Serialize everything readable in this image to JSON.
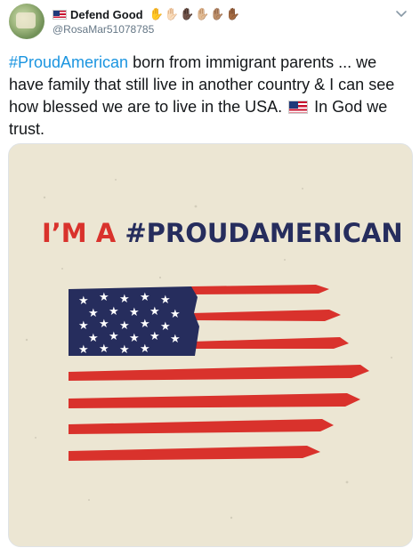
{
  "author": {
    "name": "Defend Good",
    "handle": "@RosaMar51078785"
  },
  "icons": {
    "avatar": "profile-photo",
    "name_flag": "us-flag-icon",
    "hands": [
      "raised-hand-yellow",
      "raised-hand-light",
      "raised-hand-dark",
      "raised-hand-medium-light",
      "raised-hand-medium",
      "raised-hand-brown"
    ],
    "menu": "chevron-down-icon",
    "inline_flag": "us-flag-icon"
  },
  "tweet": {
    "hashtag": "#ProudAmerican",
    "text_part1": " born from immigrant parents ... we have family that still live in another country & I can see how blessed we are to live in the USA. ",
    "text_part2": " In God we trust."
  },
  "image": {
    "headline_red": "I’M A",
    "headline_blue": " #PROUDAMERICAN",
    "colors": {
      "background": "#ece6d3",
      "red": "#d9322c",
      "blue": "#262d5d",
      "white": "#ffffff"
    }
  }
}
